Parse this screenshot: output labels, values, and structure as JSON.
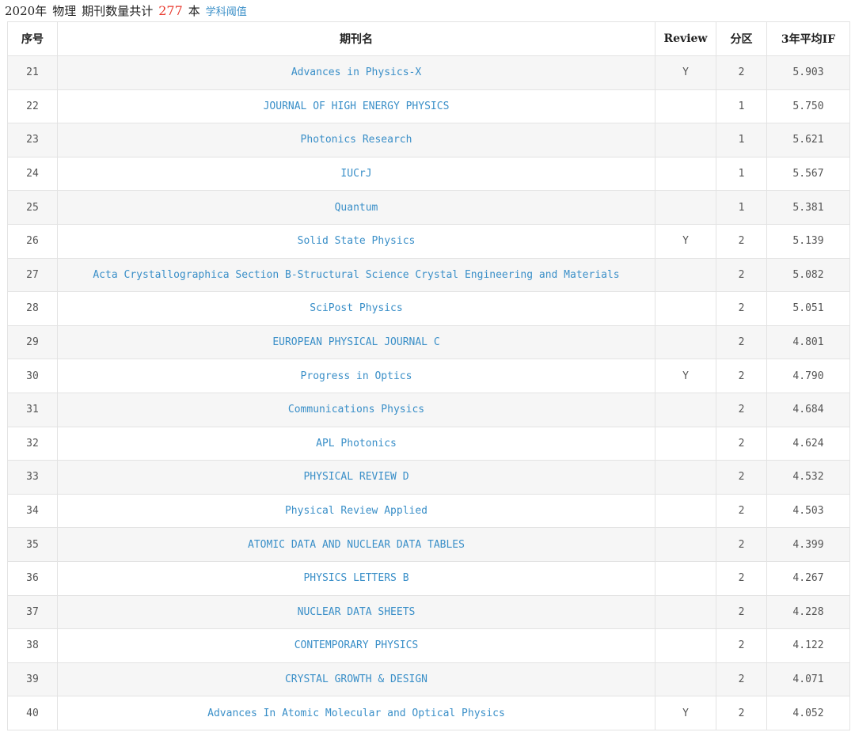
{
  "header": {
    "year": "2020年",
    "subject": "物理",
    "count_prefix": "期刊数量共计",
    "count": "277",
    "unit": "本",
    "link": "学科阈值"
  },
  "table": {
    "columns": [
      "序号",
      "期刊名",
      "Review",
      "分区",
      "3年平均IF"
    ],
    "rows": [
      {
        "no": "21",
        "name": "Advances in Physics-X",
        "review": "Y",
        "zone": "2",
        "if": "5.903"
      },
      {
        "no": "22",
        "name": "JOURNAL OF HIGH ENERGY PHYSICS",
        "review": "",
        "zone": "1",
        "if": "5.750"
      },
      {
        "no": "23",
        "name": "Photonics Research",
        "review": "",
        "zone": "1",
        "if": "5.621"
      },
      {
        "no": "24",
        "name": "IUCrJ",
        "review": "",
        "zone": "1",
        "if": "5.567"
      },
      {
        "no": "25",
        "name": "Quantum",
        "review": "",
        "zone": "1",
        "if": "5.381"
      },
      {
        "no": "26",
        "name": "Solid State Physics",
        "review": "Y",
        "zone": "2",
        "if": "5.139"
      },
      {
        "no": "27",
        "name": "Acta Crystallographica Section B-Structural Science Crystal Engineering and Materials",
        "review": "",
        "zone": "2",
        "if": "5.082"
      },
      {
        "no": "28",
        "name": "SciPost Physics",
        "review": "",
        "zone": "2",
        "if": "5.051"
      },
      {
        "no": "29",
        "name": "EUROPEAN PHYSICAL JOURNAL C",
        "review": "",
        "zone": "2",
        "if": "4.801"
      },
      {
        "no": "30",
        "name": "Progress in Optics",
        "review": "Y",
        "zone": "2",
        "if": "4.790"
      },
      {
        "no": "31",
        "name": "Communications Physics",
        "review": "",
        "zone": "2",
        "if": "4.684"
      },
      {
        "no": "32",
        "name": "APL Photonics",
        "review": "",
        "zone": "2",
        "if": "4.624"
      },
      {
        "no": "33",
        "name": "PHYSICAL REVIEW D",
        "review": "",
        "zone": "2",
        "if": "4.532"
      },
      {
        "no": "34",
        "name": "Physical Review Applied",
        "review": "",
        "zone": "2",
        "if": "4.503"
      },
      {
        "no": "35",
        "name": "ATOMIC DATA AND NUCLEAR DATA TABLES",
        "review": "",
        "zone": "2",
        "if": "4.399"
      },
      {
        "no": "36",
        "name": "PHYSICS LETTERS B",
        "review": "",
        "zone": "2",
        "if": "4.267"
      },
      {
        "no": "37",
        "name": "NUCLEAR DATA SHEETS",
        "review": "",
        "zone": "2",
        "if": "4.228"
      },
      {
        "no": "38",
        "name": "CONTEMPORARY PHYSICS",
        "review": "",
        "zone": "2",
        "if": "4.122"
      },
      {
        "no": "39",
        "name": "CRYSTAL GROWTH & DESIGN",
        "review": "",
        "zone": "2",
        "if": "4.071"
      },
      {
        "no": "40",
        "name": "Advances In Atomic Molecular and Optical Physics",
        "review": "Y",
        "zone": "2",
        "if": "4.052"
      }
    ]
  },
  "colors": {
    "link": "#3a8fc8",
    "count": "#e8382c",
    "stripe": "#f6f6f6",
    "border": "#e3e3e3"
  }
}
